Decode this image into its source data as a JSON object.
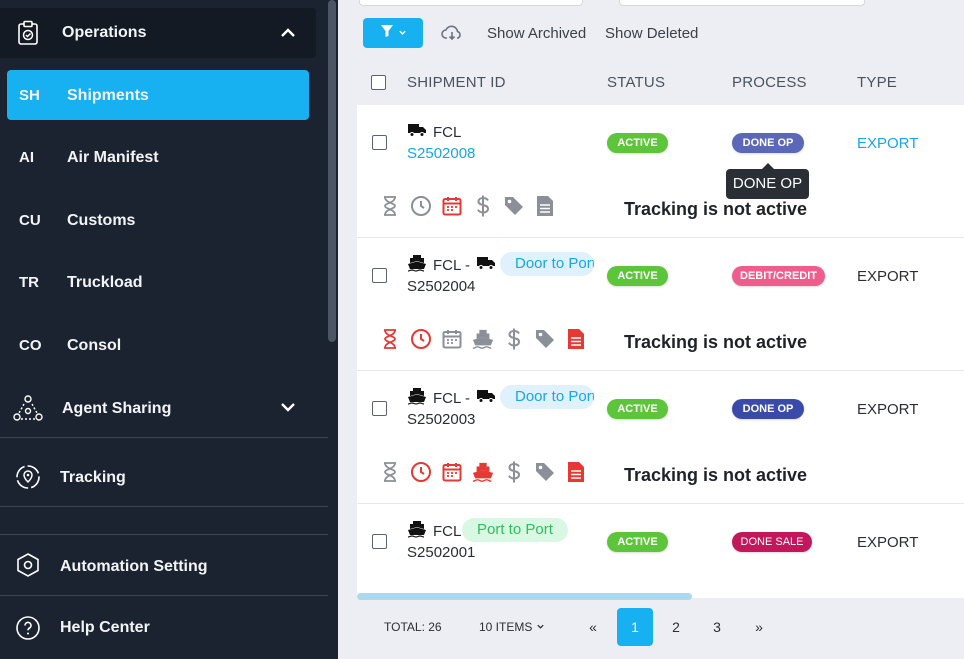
{
  "sidebar": {
    "section_title": "Operations",
    "items": [
      {
        "abbr": "SH",
        "label": "Shipments",
        "active": true
      },
      {
        "abbr": "AI",
        "label": "Air Manifest"
      },
      {
        "abbr": "CU",
        "label": "Customs"
      },
      {
        "abbr": "TR",
        "label": "Truckload"
      },
      {
        "abbr": "CO",
        "label": "Consol"
      }
    ],
    "agent_sharing": "Agent Sharing",
    "tracking": "Tracking",
    "automation": "Automation Setting",
    "help": "Help Center"
  },
  "toolbar": {
    "show_archived": "Show Archived",
    "show_deleted": "Show Deleted"
  },
  "table": {
    "headers": {
      "shipment_id": "SHIPMENT ID",
      "status": "STATUS",
      "process": "PROCESS",
      "type": "TYPE"
    },
    "rows": [
      {
        "mode": "FCL",
        "id": "S2502008",
        "status": "ACTIVE",
        "process": "DONE OP",
        "type": "EXPORT",
        "tracking": "Tracking is not active"
      },
      {
        "mode": "FCL -",
        "tag": "Door to Port",
        "id": "S2502004",
        "status": "ACTIVE",
        "process": "DEBIT/CREDIT",
        "type": "EXPORT",
        "tracking": "Tracking is not active"
      },
      {
        "mode": "FCL -",
        "tag": "Door to Port",
        "id": "S2502003",
        "status": "ACTIVE",
        "process": "DONE OP",
        "type": "EXPORT",
        "tracking": "Tracking is not active"
      },
      {
        "mode": "FCL",
        "tag": "Port to Port",
        "id": "S2502001",
        "status": "ACTIVE",
        "process": "DONE SALE",
        "type": "EXPORT"
      }
    ],
    "tooltip": "DONE OP"
  },
  "pagination": {
    "total": "TOTAL: 26",
    "per_page": "10 ITEMS",
    "prev": "«",
    "pages": [
      "1",
      "2",
      "3"
    ],
    "next": "»",
    "current": "1"
  },
  "colors": {
    "accent": "#17b0f0",
    "sidebar_bg": "#1b2230",
    "active_green": "#5cc53a",
    "red_icon": "#e53935"
  }
}
